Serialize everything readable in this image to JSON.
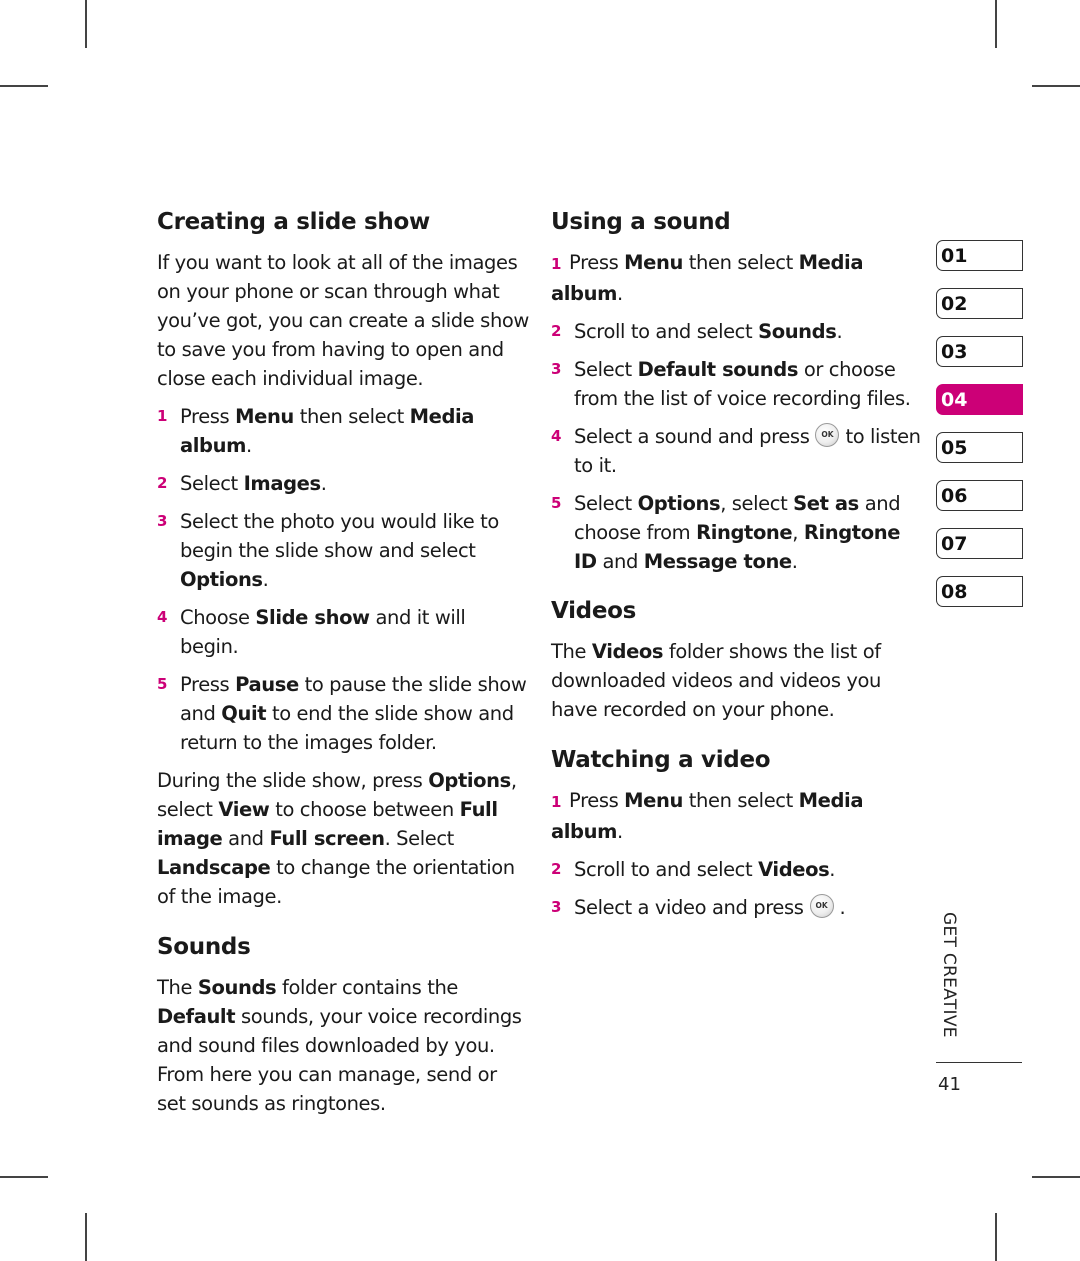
{
  "left_column": {
    "slide_show": {
      "heading": "Creating a slide show",
      "intro": "If you want to look at all of the images on your phone or scan through what you’ve got, you can create a slide show to save you from having to open and close each individual image.",
      "steps": [
        {
          "num": "1",
          "parts": [
            [
              "",
              "Press "
            ],
            [
              "b",
              "Menu"
            ],
            [
              "",
              " then select "
            ],
            [
              "b",
              "Media album"
            ],
            [
              "",
              "."
            ]
          ]
        },
        {
          "num": "2",
          "parts": [
            [
              "",
              "Select "
            ],
            [
              "b",
              "Images"
            ],
            [
              "",
              "."
            ]
          ]
        },
        {
          "num": "3",
          "parts": [
            [
              "",
              "Select the photo you would like to begin the slide show and select "
            ],
            [
              "b",
              "Options"
            ],
            [
              "",
              "."
            ]
          ]
        },
        {
          "num": "4",
          "parts": [
            [
              "",
              "Choose "
            ],
            [
              "b",
              "Slide show"
            ],
            [
              "",
              " and it will begin."
            ]
          ]
        },
        {
          "num": "5",
          "parts": [
            [
              "",
              "Press "
            ],
            [
              "b",
              "Pause"
            ],
            [
              "",
              " to pause the slide show and "
            ],
            [
              "b",
              "Quit"
            ],
            [
              "",
              " to end the slide show and return to the images folder."
            ]
          ]
        }
      ],
      "note_parts": [
        [
          "",
          "During the slide show, press "
        ],
        [
          "b",
          "Options"
        ],
        [
          "",
          ", select "
        ],
        [
          "b",
          "View"
        ],
        [
          "",
          " to choose between "
        ],
        [
          "b",
          "Full image"
        ],
        [
          "",
          " and "
        ],
        [
          "b",
          "Full screen"
        ],
        [
          "",
          ". Select "
        ],
        [
          "b",
          "Landscape"
        ],
        [
          "",
          " to change the orientation of the image."
        ]
      ]
    },
    "sounds": {
      "heading": "Sounds",
      "body_parts": [
        [
          "",
          "The "
        ],
        [
          "b",
          "Sounds"
        ],
        [
          "",
          " folder contains the "
        ],
        [
          "b",
          "Default"
        ],
        [
          "",
          " sounds, your voice recordings and sound files downloaded by you. From here you can manage, send or set sounds as ringtones."
        ]
      ]
    }
  },
  "right_column": {
    "using_sound": {
      "heading": "Using a sound",
      "steps": [
        {
          "num": "1",
          "parts": [
            [
              "",
              "Press "
            ],
            [
              "b",
              "Menu"
            ],
            [
              "",
              " then select "
            ],
            [
              "b",
              "Media album"
            ],
            [
              "",
              "."
            ]
          ]
        },
        {
          "num": "2",
          "parts": [
            [
              "",
              "Scroll to and select "
            ],
            [
              "b",
              "Sounds"
            ],
            [
              "",
              "."
            ]
          ]
        },
        {
          "num": "3",
          "parts": [
            [
              "",
              "Select "
            ],
            [
              "b",
              "Default sounds"
            ],
            [
              "",
              " or choose from the list of voice recording files."
            ]
          ]
        },
        {
          "num": "4",
          "parts": [
            [
              "",
              "Select a sound and press"
            ],
            [
              "ok",
              "OK"
            ],
            [
              "",
              "to listen to it."
            ]
          ]
        },
        {
          "num": "5",
          "parts": [
            [
              "",
              "Select "
            ],
            [
              "b",
              "Options"
            ],
            [
              "",
              ", select "
            ],
            [
              "b",
              "Set as"
            ],
            [
              "",
              " and choose from "
            ],
            [
              "b",
              "Ringtone"
            ],
            [
              "",
              ", "
            ],
            [
              "b",
              "Ringtone ID"
            ],
            [
              "",
              " and "
            ],
            [
              "b",
              "Message tone"
            ],
            [
              "",
              "."
            ]
          ]
        }
      ]
    },
    "videos": {
      "heading": "Videos",
      "body_parts": [
        [
          "",
          "The "
        ],
        [
          "b",
          "Videos"
        ],
        [
          "",
          " folder shows the list of downloaded videos and videos you have recorded on your phone."
        ]
      ]
    },
    "watching_video": {
      "heading": "Watching a video",
      "steps": [
        {
          "num": "1",
          "parts": [
            [
              "",
              "Press "
            ],
            [
              "b",
              "Menu"
            ],
            [
              "",
              " then select "
            ],
            [
              "b",
              "Media album"
            ],
            [
              "",
              "."
            ]
          ]
        },
        {
          "num": "2",
          "parts": [
            [
              "",
              "Scroll to and select "
            ],
            [
              "b",
              "Videos"
            ],
            [
              "",
              "."
            ]
          ]
        },
        {
          "num": "3",
          "parts": [
            [
              "",
              "Select a video and press"
            ],
            [
              "ok",
              "OK"
            ],
            [
              "",
              "."
            ]
          ]
        }
      ]
    }
  },
  "chapter_tabs": {
    "items": [
      "01",
      "02",
      "03",
      "04",
      "05",
      "06",
      "07",
      "08"
    ],
    "active": "04",
    "accent_color": "#cc0077"
  },
  "footer": {
    "section_label": "GET CREATIVE",
    "page_number": "41"
  },
  "icons": {
    "ok_button": "ok-key-icon"
  }
}
